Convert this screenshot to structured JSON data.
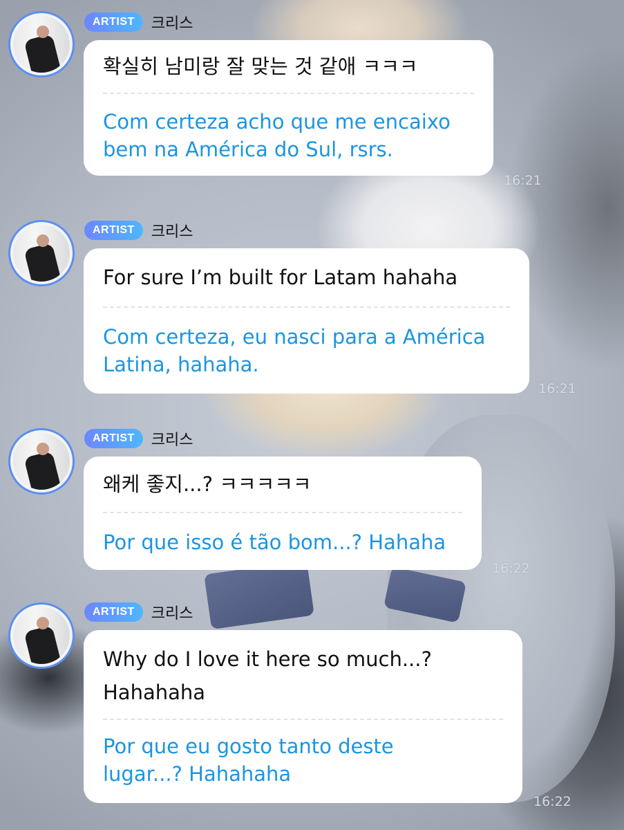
{
  "messages": [
    {
      "badge": "ARTIST",
      "sender": "크리스",
      "original": "확실히 남미랑 잘 맞는 것 같애 ㅋㅋㅋ",
      "translation": "Com certeza acho que me encaixo bem na América do Sul, rsrs.",
      "time": "16:21"
    },
    {
      "badge": "ARTIST",
      "sender": "크리스",
      "original": "For sure I’m built for Latam hahaha",
      "translation": "Com certeza, eu nasci para a América Latina, hahaha.",
      "time": "16:21"
    },
    {
      "badge": "ARTIST",
      "sender": "크리스",
      "original": "왜케 좋지...? ㅋㅋㅋㅋㅋ",
      "translation": "Por que isso é tão bom...? Hahaha",
      "time": "16:22"
    },
    {
      "badge": "ARTIST",
      "sender": "크리스",
      "original": "Why do I love it here so much...? Hahahaha",
      "translation": "Por que eu gosto tanto deste lugar...? Hahahaha",
      "time": "16:22"
    }
  ],
  "colors": {
    "badge": "#5b8ef7",
    "translation_text": "#1b95e0",
    "avatar_ring": "#5a8ff2"
  }
}
